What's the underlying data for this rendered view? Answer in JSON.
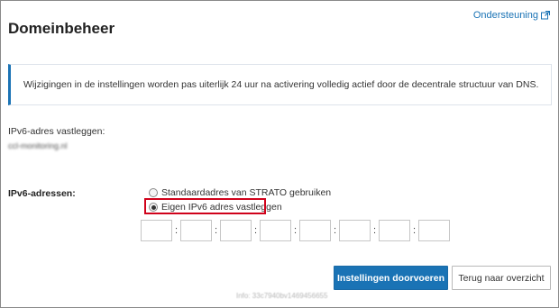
{
  "header": {
    "support_link_label": "Ondersteuning",
    "support_icon": "external-link-icon",
    "title": "Domeinbeheer"
  },
  "info_banner": {
    "message": "Wijzigingen in de instellingen worden pas uiterlijk 24 uur na activering volledig actief door de decentrale structuur van DNS.",
    "accent_color": "#1a73b5"
  },
  "ipv6_section": {
    "heading": "IPv6-adres vastleggen:",
    "domain": "ccl-monitoring.nl"
  },
  "addresses": {
    "label": "IPv6-adressen:",
    "options": [
      {
        "label": "Standaardadres van STRATO gebruiken",
        "selected": false
      },
      {
        "label": "Eigen IPv6 adres vastleggen",
        "selected": true
      }
    ],
    "separator": ":",
    "fields": [
      "",
      "",
      "",
      "",
      "",
      "",
      "",
      ""
    ],
    "highlight_color": "#d0021b"
  },
  "actions": {
    "apply_label": "Instellingen doorvoeren",
    "back_label": "Terug naar overzicht"
  },
  "footer": {
    "info_text": "Info: 33c7940bv1469456655"
  }
}
